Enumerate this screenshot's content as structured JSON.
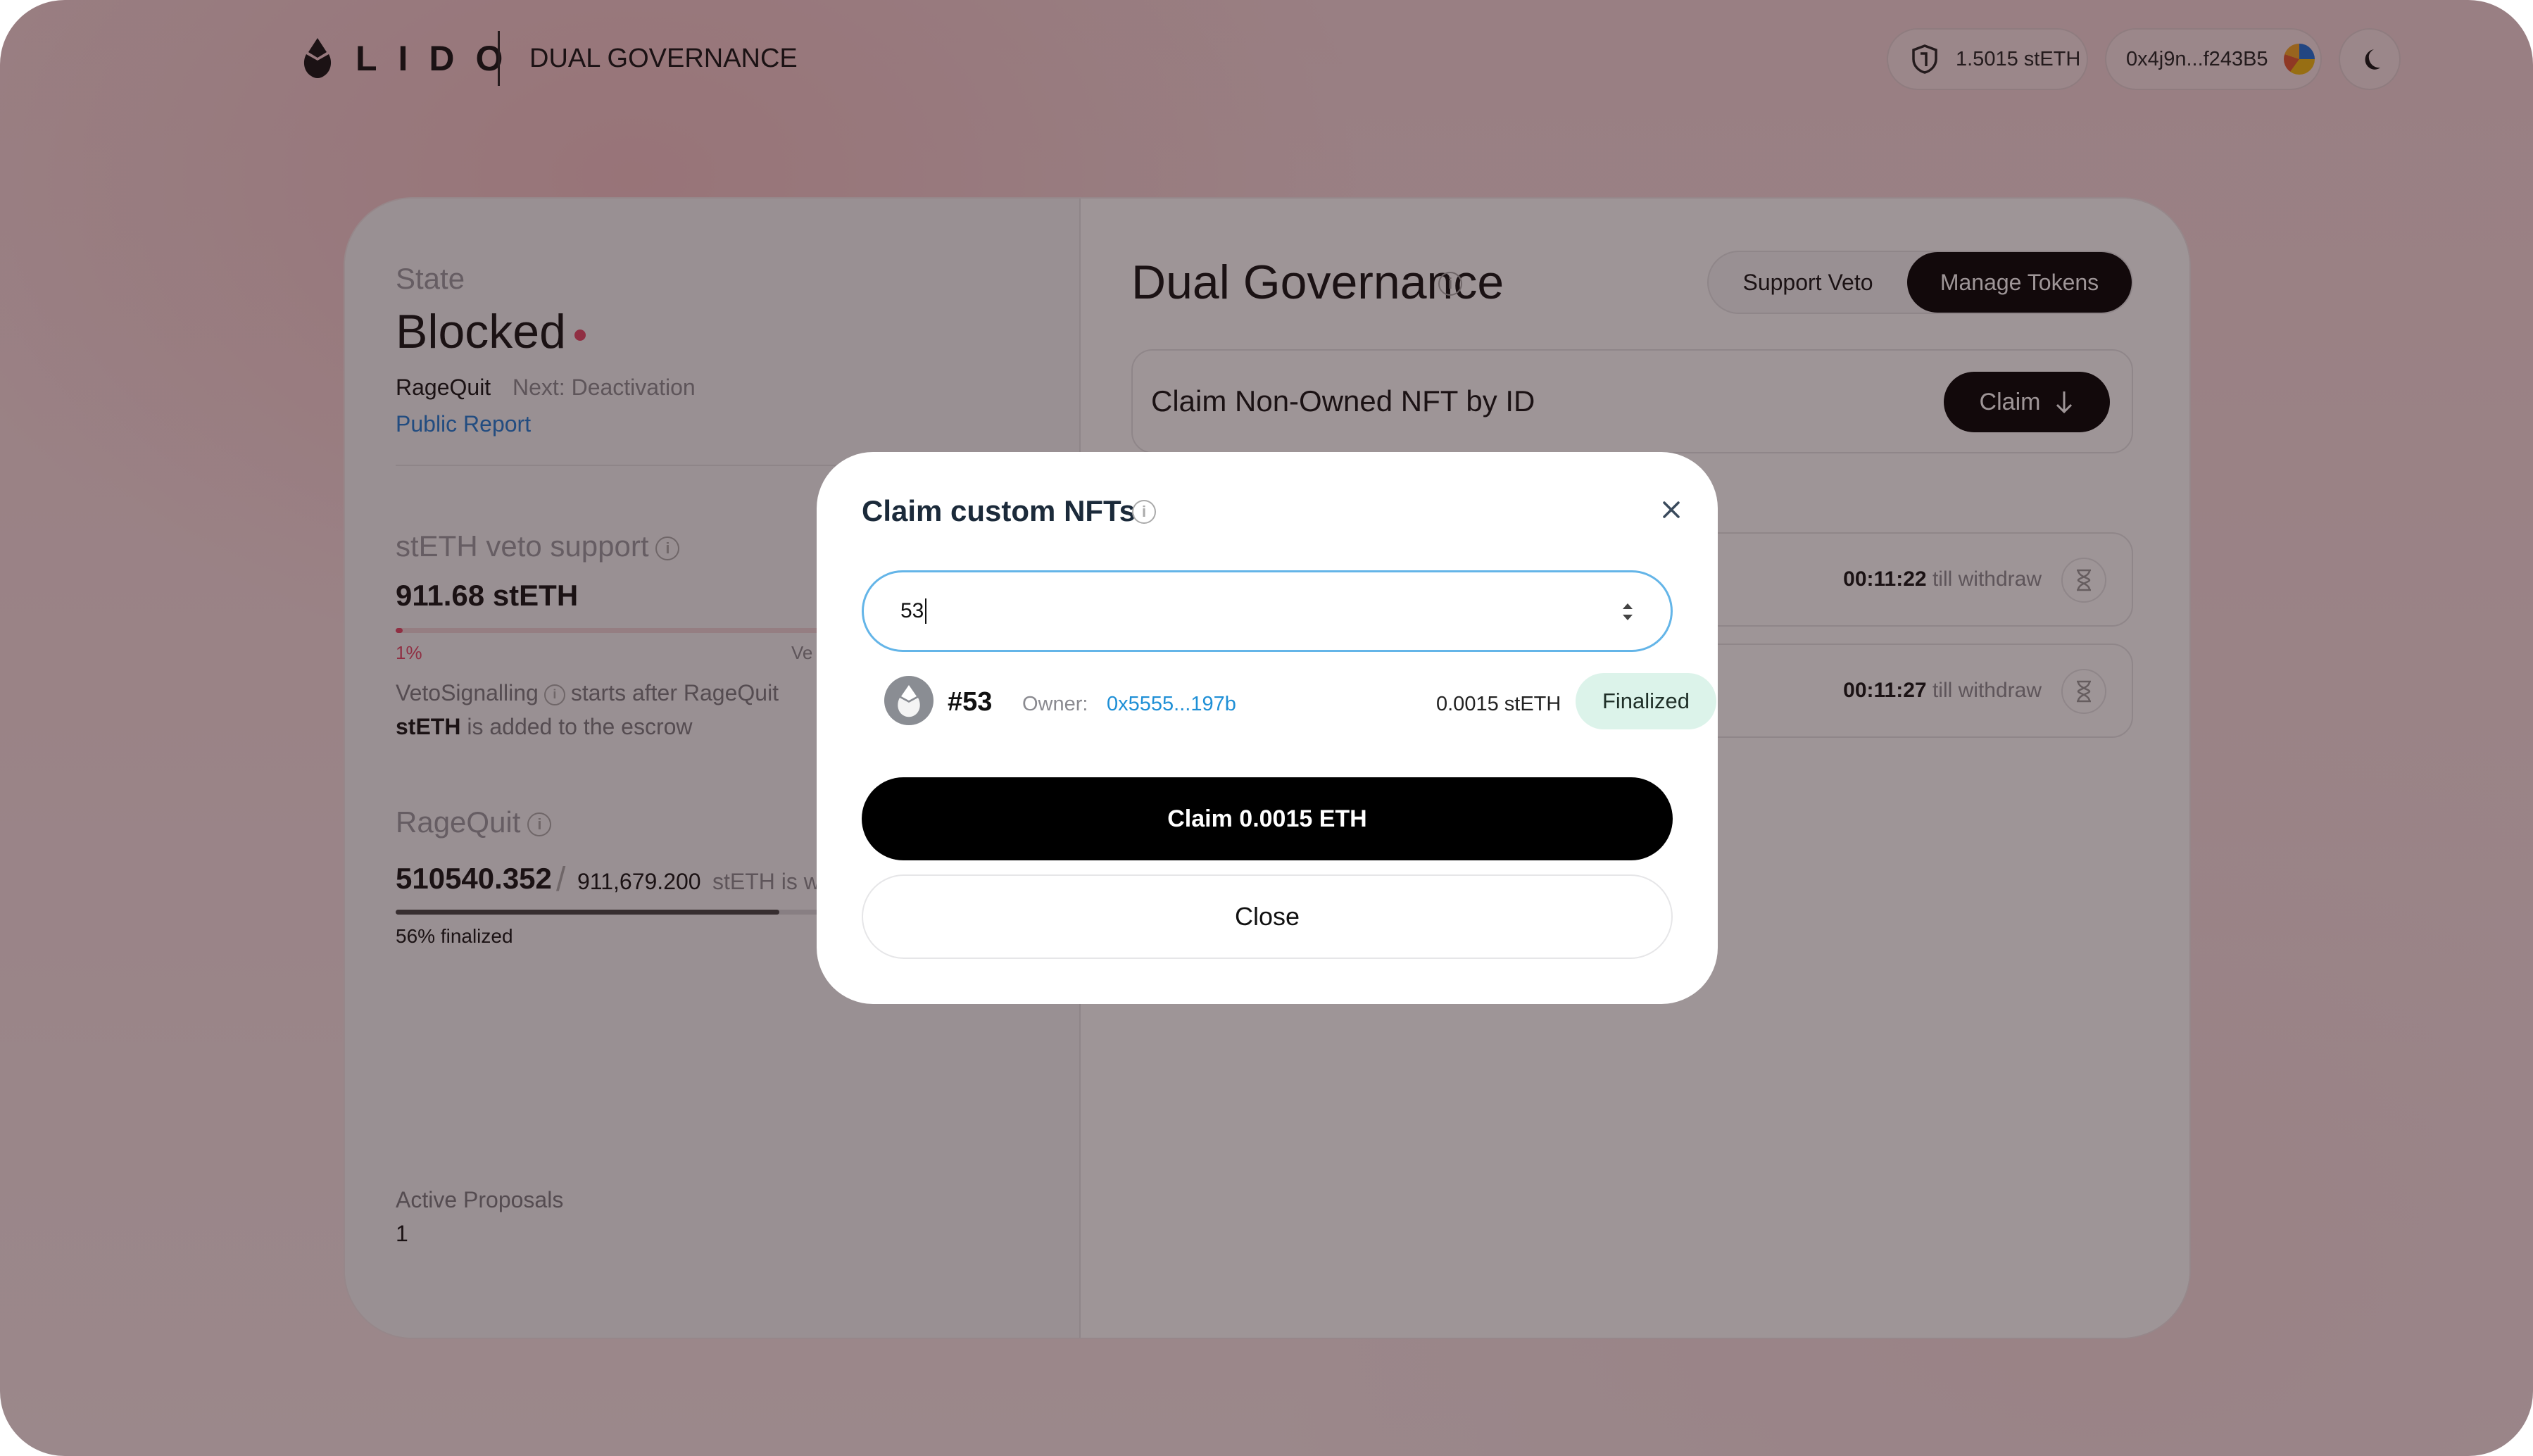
{
  "header": {
    "logo_text": "LIDO",
    "app_name": "DUAL GOVERNANCE",
    "balance": "1.5015 stETH",
    "address": "0x4j9n...f243B5"
  },
  "state": {
    "label": "State",
    "value": "Blocked",
    "sub": "RageQuit",
    "next": "Next: Deactivation",
    "report_link": "Public Report",
    "status_color": "#e54666"
  },
  "veto": {
    "label": "stETH veto support",
    "value": "911.68 stETH",
    "progress_percent": 1,
    "pct_label": "1%",
    "right_label": "Ve",
    "note_line1_a": "VetoSignalling",
    "note_line1_b": "starts after RageQuit",
    "note_line2_bold": "stETH",
    "note_line2_rest": "is added to the escrow"
  },
  "ragequit": {
    "label": "RageQuit",
    "value": "510540.352",
    "slash": "/",
    "total": "911,679.200",
    "suffix": "stETH is w",
    "progress_percent": 56,
    "pct_label": "56% finalized"
  },
  "proposals": {
    "label": "Active Proposals",
    "value": "1"
  },
  "main": {
    "title": "Dual Governance",
    "toggle": [
      "Support Veto",
      "Manage Tokens"
    ],
    "claim_box_title": "Claim Non-Owned NFT by ID",
    "claim_button": "Claim",
    "withdraw_rows": [
      {
        "time": "00:11:22",
        "suffix": "till withdraw"
      },
      {
        "time": "00:11:27",
        "suffix": "till withdraw"
      }
    ]
  },
  "modal": {
    "title": "Claim custom NFTs",
    "input_value": "53",
    "nft": {
      "id": "#53",
      "owner_label": "Owner:",
      "owner": "0x5555...197b",
      "amount": "0.0015 stETH",
      "status": "Finalized"
    },
    "primary_button": "Claim 0.0015 ETH",
    "secondary_button": "Close"
  },
  "colors": {
    "accent_red": "#e54666",
    "link_blue": "#1e7bd6",
    "input_border": "#64b5e8",
    "badge_bg": "#dcf3ea"
  }
}
